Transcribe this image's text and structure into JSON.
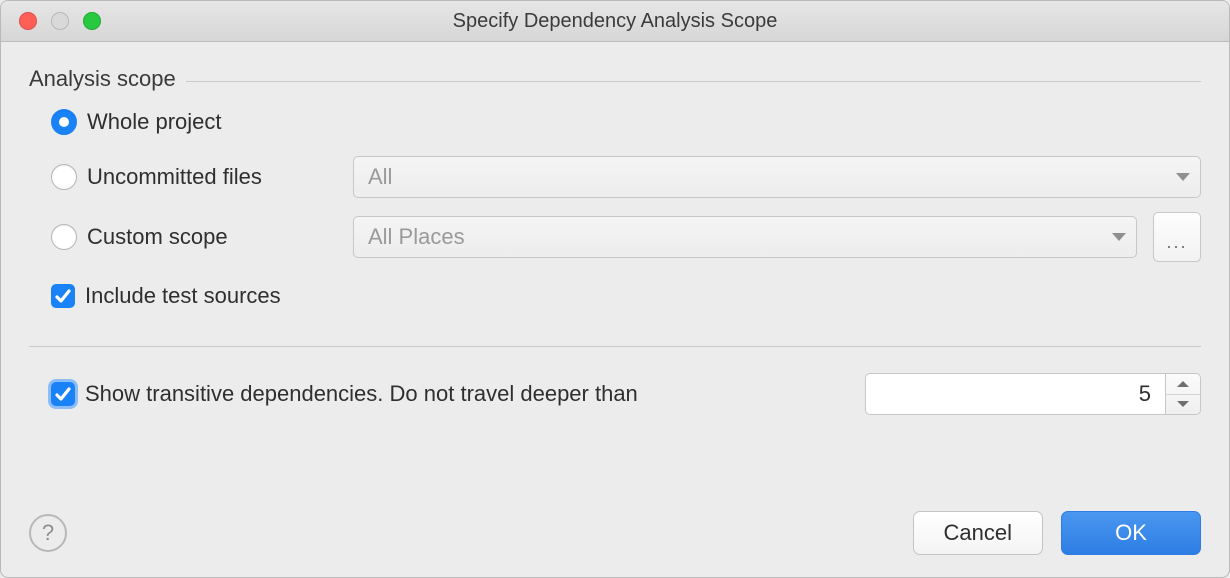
{
  "window": {
    "title": "Specify Dependency Analysis Scope"
  },
  "fieldset": {
    "legend": "Analysis scope"
  },
  "options": {
    "whole_project": {
      "label": "Whole project",
      "selected": true
    },
    "uncommitted_files": {
      "label": "Uncommitted files",
      "selected": false,
      "combo_value": "All"
    },
    "custom_scope": {
      "label": "Custom scope",
      "selected": false,
      "combo_value": "All Places",
      "dots": "..."
    },
    "include_tests": {
      "label": "Include test sources",
      "checked": true
    }
  },
  "transitive": {
    "label": "Show transitive dependencies. Do not travel deeper than",
    "checked": true,
    "value": "5"
  },
  "buttons": {
    "help": "?",
    "cancel": "Cancel",
    "ok": "OK"
  }
}
